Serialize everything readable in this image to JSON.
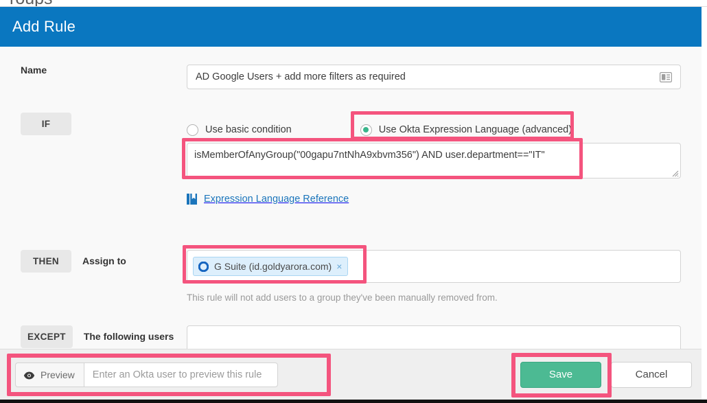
{
  "background": {
    "breadcrumb": "roups"
  },
  "modal": {
    "title": "Add Rule",
    "name_row": {
      "label": "Name",
      "value": "AD Google Users + add more filters as required",
      "icon": "contact-card-icon"
    },
    "if_row": {
      "badge": "IF",
      "options": [
        {
          "label": "Use basic condition",
          "selected": false
        },
        {
          "label": "Use Okta Expression Language (advanced)",
          "selected": true
        }
      ],
      "expression": "isMemberOfAnyGroup(\"00gapu7ntNhA9xbvm356\") AND user.department==\"IT\"",
      "reference_link": "Expression Language Reference",
      "reference_icon": "book-icon"
    },
    "then_row": {
      "badge": "THEN",
      "label": "Assign to",
      "chip": {
        "label": "G Suite (id.goldyarora.com)",
        "icon": "okta-circle-icon",
        "remove": "×"
      },
      "hint": "This rule will not add users to a group they've been manually removed from."
    },
    "except_row": {
      "badge": "EXCEPT",
      "label": "The following users",
      "value": ""
    },
    "footer": {
      "preview_label": "Preview",
      "preview_icon": "eye-icon",
      "preview_placeholder": "Enter an Okta user to preview this rule",
      "save_label": "Save",
      "cancel_label": "Cancel"
    }
  },
  "colors": {
    "header_blue": "#0a77c0",
    "highlight_pink": "#f4547e",
    "save_green": "#4cba93",
    "radio_green": "#3ab58b",
    "link_blue": "#1b75bb"
  }
}
